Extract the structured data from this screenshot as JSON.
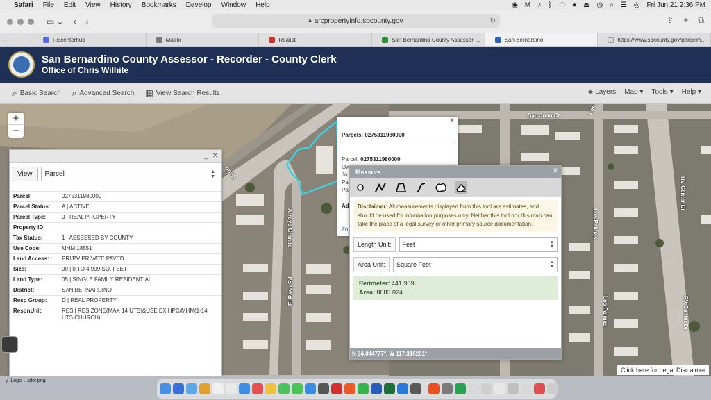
{
  "menubar": {
    "app_name": "Safari",
    "items": [
      "File",
      "Edit",
      "View",
      "History",
      "Bookmarks",
      "Develop",
      "Window",
      "Help"
    ],
    "datetime": "Fri Jun 21  2:36 PM"
  },
  "browser": {
    "url": "arcpropertyinfo.sbcounty.gov",
    "tabs": [
      {
        "label": "REcenterhub",
        "fav_color": "#5a6bd6"
      },
      {
        "label": "Matrix",
        "fav_color": "#7a7a7a"
      },
      {
        "label": "Realist",
        "fav_color": "#c0392b"
      },
      {
        "label": "San Bernardino County Assessor-...",
        "fav_color": "#2f8f3a"
      },
      {
        "label": "San Bernardino",
        "fav_color": "#2a62b8"
      },
      {
        "label": "https://www.sbcounty.gov/parcelm...",
        "fav_color": "#999999"
      }
    ],
    "active_tab_index": 4
  },
  "site": {
    "title": "San Bernardino County Assessor - Recorder - County Clerk",
    "subtitle": "Office of Chris Wilhite"
  },
  "nav": {
    "basic_search": "Basic Search",
    "advanced_search": "Advanced Search",
    "view_results": "View Search Results",
    "layers": "Layers",
    "map": "Map",
    "tools": "Tools",
    "help": "Help"
  },
  "map": {
    "streets": {
      "san_juan_ct": "San Juan Ct",
      "los_palmas": "Los Palmas",
      "arroyo_grande": "Arroyo Grande",
      "el_paso_rd": "El Paso Rd",
      "rv_center_dr": "RV Center Dr",
      "on_st": "on St"
    },
    "zoom_in": "+",
    "zoom_out": "−",
    "legal_disclaimer": "Click here for Legal Disclaimer"
  },
  "parcel_panel": {
    "view_label": "View",
    "view_select": "Parcel",
    "rows": [
      {
        "key": "Parcel:",
        "value": "0275311980000"
      },
      {
        "key": "Parcel Status:",
        "value": "A | ACTIVE"
      },
      {
        "key": "Parcel Type:",
        "value": "0 | REAL PROPERTY"
      },
      {
        "key": "Property ID:",
        "value": ""
      },
      {
        "key": "Tax Status:",
        "value": "1 | ASSESSED BY COUNTY"
      },
      {
        "key": "Use Code:",
        "value": "MHM 18551"
      },
      {
        "key": "Land Access:",
        "value": "PRI/PV PRIVATE PAVED"
      },
      {
        "key": "Size:",
        "value": "00 | 0 TO 4,999 SQ. FEET"
      },
      {
        "key": "Land Type:",
        "value": "05 | SINGLE FAMILY RESIDENTIAL"
      },
      {
        "key": "District:",
        "value": "SAN BERNARDINO"
      },
      {
        "key": "Resp Group:",
        "value": "D | REAL PROPERTY"
      },
      {
        "key": "RespnUnit:",
        "value": "RES | RES ZONE(MAX 14 UTS)&USE EX HPC/MHM(1-14 UTS,CHURCH)"
      }
    ]
  },
  "popup": {
    "title": "Parcels: 0275311980000",
    "parcel_label": "Parcel:",
    "parcel_value": "0275311980000",
    "lines": [
      "Ow",
      "Jo",
      "Pa",
      "Pa"
    ],
    "ad": "Ad",
    "zoom": "Zo"
  },
  "measure": {
    "title": "Measure",
    "disclaimer_label": "Disclaimer:",
    "disclaimer_text": "All measurements displayed from this tool are estimates, and should be used for information purposes only. Neither this tool nor this map can take the place of a legal survey or other primary source documentation.",
    "length_unit_label": "Length Unit:",
    "length_unit": "Feet",
    "area_unit_label": "Area Unit:",
    "area_unit": "Square Feet",
    "perimeter_label": "Perimeter:",
    "perimeter_value": "441.959",
    "area_label": "Area:",
    "area_value": "8683.024",
    "coordinates": "N 34.044777°, W 117.316261°"
  },
  "desktop": {
    "file_label": "y_Logo_...olor.png"
  },
  "colors": {
    "header_bg": "#1f3057",
    "parcel_outline": "#3fd0e0",
    "result_bg": "#dfecd7",
    "disclaimer_bg": "#fbf6e6"
  },
  "dock_icons": [
    "#4a8fe0",
    "#3a6fd8",
    "#5fa8e8",
    "#e0a030",
    "#f0f0f0",
    "#e8e8e8",
    "#3d8ee0",
    "#e85050",
    "#f0c040",
    "#4cc35a",
    "#4cc35a",
    "#3a8de0",
    "#555555",
    "#d03030",
    "#e85a2a",
    "#38b24a",
    "#2a5cb8",
    "#1e6e3a",
    "#2a7ad8",
    "#5a5a5a",
    "#e85020",
    "#7a7a7a",
    "#2aa050",
    "#d8d8d8",
    "#cfcfcf",
    "#e8e8e8",
    "#c0c0c0",
    "#d8d8d8",
    "#e05050",
    "#cccccc"
  ]
}
